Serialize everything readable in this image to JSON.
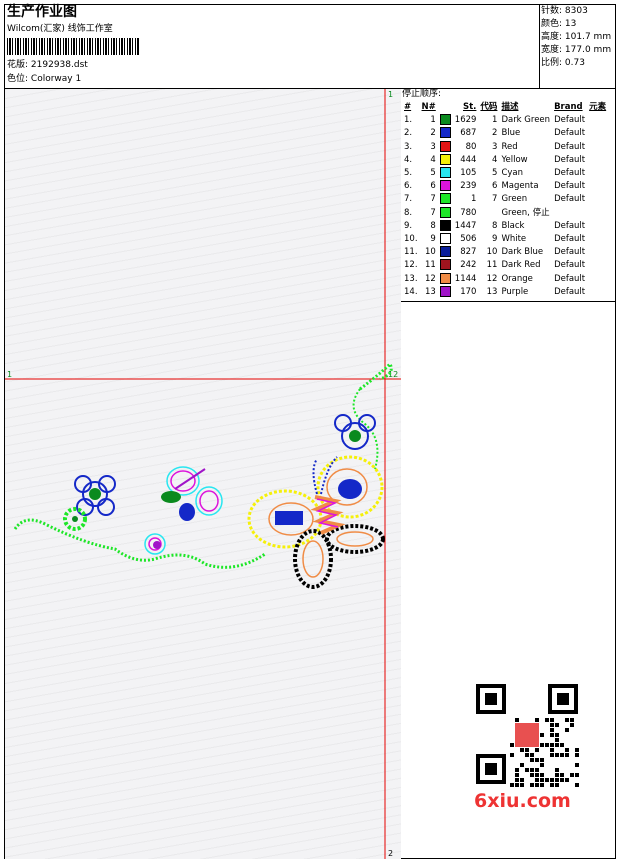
{
  "header": {
    "title": "生产作业图",
    "company": "Wilcom(汇家) 线饰工作室",
    "design_file_label": "花版:",
    "design_file": "2192938.dst",
    "colorway_label": "色位:",
    "colorway": "Colorway 1"
  },
  "specs": {
    "stitches_label": "针数:",
    "stitches": "8303",
    "colors_label": "颜色:",
    "colors": "13",
    "height_label": "高度:",
    "height": "101.7 mm",
    "width_label": "宽度:",
    "width": "177.0 mm",
    "scale_label": "比例:",
    "scale": "0.73"
  },
  "stop_sequence_title": "停止顺序:",
  "table": {
    "headers": [
      "#",
      "N#",
      "St.",
      "代码",
      "描述",
      "Brand",
      "元素"
    ],
    "rows": [
      {
        "idx": "1.",
        "n": "1",
        "color": "#0a8a1e",
        "st": "1629",
        "code": "1",
        "desc": "Dark Green",
        "brand": "Default"
      },
      {
        "idx": "2.",
        "n": "2",
        "color": "#1428c8",
        "st": "687",
        "code": "2",
        "desc": "Blue",
        "brand": "Default"
      },
      {
        "idx": "3.",
        "n": "3",
        "color": "#e31414",
        "st": "80",
        "code": "3",
        "desc": "Red",
        "brand": "Default"
      },
      {
        "idx": "4.",
        "n": "4",
        "color": "#f5f00a",
        "st": "444",
        "code": "4",
        "desc": "Yellow",
        "brand": "Default"
      },
      {
        "idx": "5.",
        "n": "5",
        "color": "#28e6f0",
        "st": "105",
        "code": "5",
        "desc": "Cyan",
        "brand": "Default"
      },
      {
        "idx": "6.",
        "n": "6",
        "color": "#dc14dc",
        "st": "239",
        "code": "6",
        "desc": "Magenta",
        "brand": "Default"
      },
      {
        "idx": "7.",
        "n": "7",
        "color": "#1ee628",
        "st": "1",
        "code": "7",
        "desc": "Green",
        "brand": "Default"
      },
      {
        "idx": "8.",
        "n": "7",
        "color": "#1ee628",
        "st": "780",
        "code": "",
        "desc": "Green, 停止",
        "brand": ""
      },
      {
        "idx": "9.",
        "n": "8",
        "color": "#000000",
        "st": "1447",
        "code": "8",
        "desc": "Black",
        "brand": "Default"
      },
      {
        "idx": "10.",
        "n": "9",
        "color": "#ffffff",
        "st": "506",
        "code": "9",
        "desc": "White",
        "brand": "Default"
      },
      {
        "idx": "11.",
        "n": "10",
        "color": "#0a1e9a",
        "st": "827",
        "code": "10",
        "desc": "Dark Blue",
        "brand": "Default"
      },
      {
        "idx": "12.",
        "n": "11",
        "color": "#a0141e",
        "st": "242",
        "code": "11",
        "desc": "Dark Red",
        "brand": "Default"
      },
      {
        "idx": "13.",
        "n": "12",
        "color": "#f08c46",
        "st": "1144",
        "code": "12",
        "desc": "Orange",
        "brand": "Default"
      },
      {
        "idx": "14.",
        "n": "13",
        "color": "#a014c8",
        "st": "170",
        "code": "13",
        "desc": "Purple",
        "brand": "Default"
      }
    ]
  },
  "guides": {
    "top": "1",
    "left": "1",
    "corner": "12",
    "bottom": "2"
  },
  "watermark": {
    "site": "6xiu.com"
  },
  "colors": {
    "guide_line": "#e60000"
  }
}
